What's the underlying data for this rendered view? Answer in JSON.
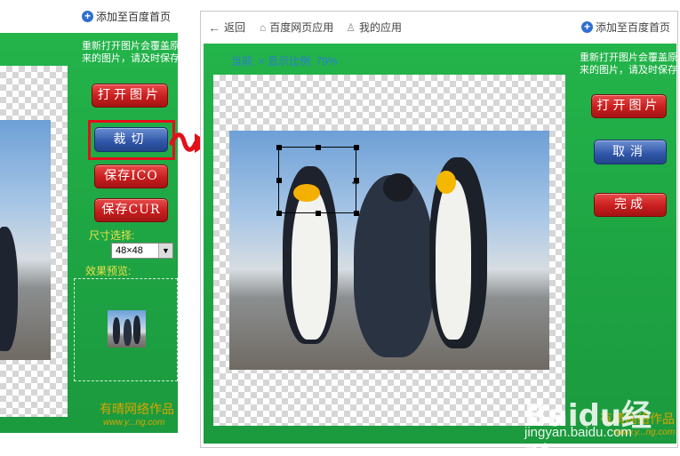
{
  "left_panel": {
    "add_home_link": "添加至百度首页",
    "notice": "重新打开图片会覆盖原来的图片，请及时保存",
    "buttons": {
      "open_image": "打开图片",
      "crop": "裁切",
      "save_ico": "保存ICO",
      "save_cur": "保存CUR"
    },
    "size_label": "尺寸选择:",
    "size_value": "48×48",
    "preview_label": "效果预览:",
    "watermark_cn": "有晴网络作品",
    "watermark_url": "www.y...ng.com"
  },
  "right_window": {
    "nav": {
      "back": "返回",
      "baidu_apps": "百度网页应用",
      "my_apps": "我的应用",
      "add_home_link": "添加至百度首页"
    },
    "status": "当前: × 显示比例: 79%",
    "notice": "重新打开图片会覆盖原来的图片，请及时保存",
    "buttons": {
      "open_image": "打开图片",
      "cancel": "取消",
      "done": "完成"
    },
    "watermark_cn": "有晴网络作品",
    "watermark_url": "www.y...ng.com"
  },
  "overlay": {
    "baidu_logo": "Baidu经验",
    "url": "jingyan.baidu.com"
  },
  "colors": {
    "panel_green": "#1ea443",
    "highlight_red": "#e3101a",
    "button_red": "#c81e1e",
    "button_blue": "#2f55a8"
  }
}
